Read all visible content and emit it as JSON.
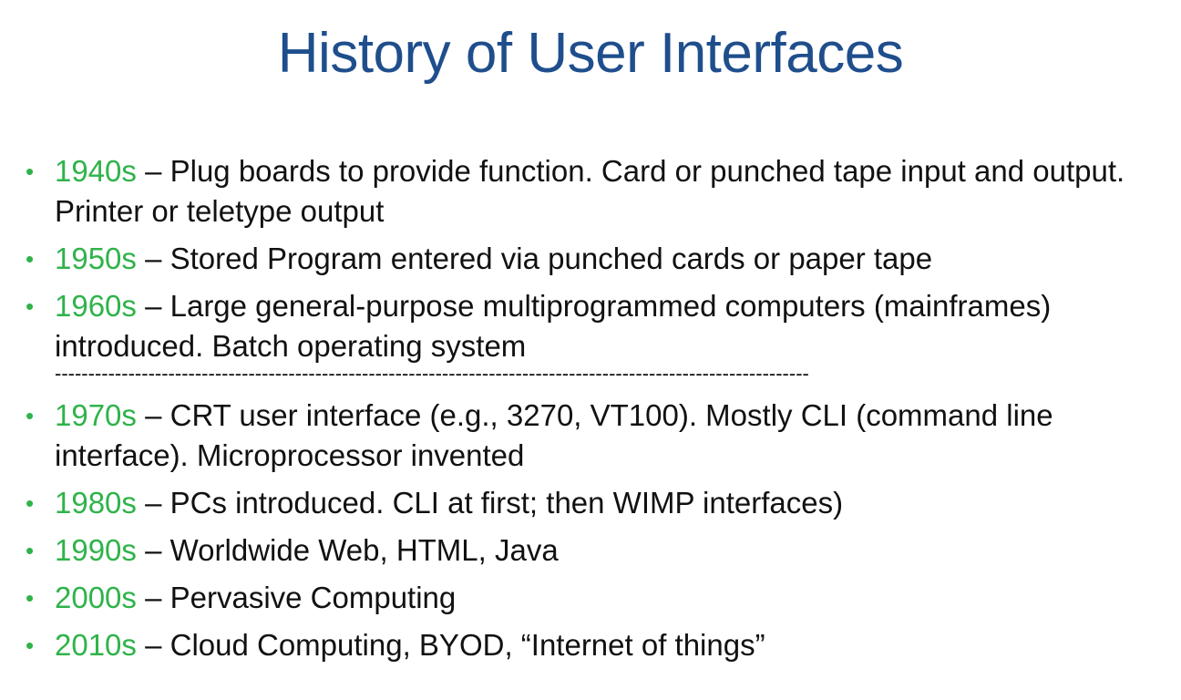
{
  "slide": {
    "title": "History of User Interfaces",
    "accent_color": "#2fb34a",
    "title_color": "#1f4e8c",
    "bullet_glyph": "•",
    "items_before": [
      {
        "decade": "1940s",
        "text": " – Plug boards to provide function.  Card or punched tape input and output.  Printer or teletype output"
      },
      {
        "decade": "1950s",
        "text": " – Stored Program entered via punched cards or paper tape"
      },
      {
        "decade": "1960s",
        "text": " – Large general-purpose  multiprogrammed  computers (mainframes)  introduced.  Batch operating system"
      }
    ],
    "separator": "-----------------------------------------------------------------------------------------------------------------",
    "items_after": [
      {
        "decade": "1970s",
        "text": " – CRT user interface (e.g., 3270, VT100).   Mostly CLI (command line interface).   Microprocessor invented"
      },
      {
        "decade": "1980s",
        "text": " – PCs introduced.  CLI at first; then WIMP interfaces)"
      },
      {
        "decade": "1990s",
        "text": " – Worldwide Web, HTML, Java"
      },
      {
        "decade": "2000s",
        "text": " – Pervasive  Computing"
      },
      {
        "decade": "2010s",
        "text": " – Cloud  Computing,  BYOD, “Internet of things”"
      }
    ]
  }
}
